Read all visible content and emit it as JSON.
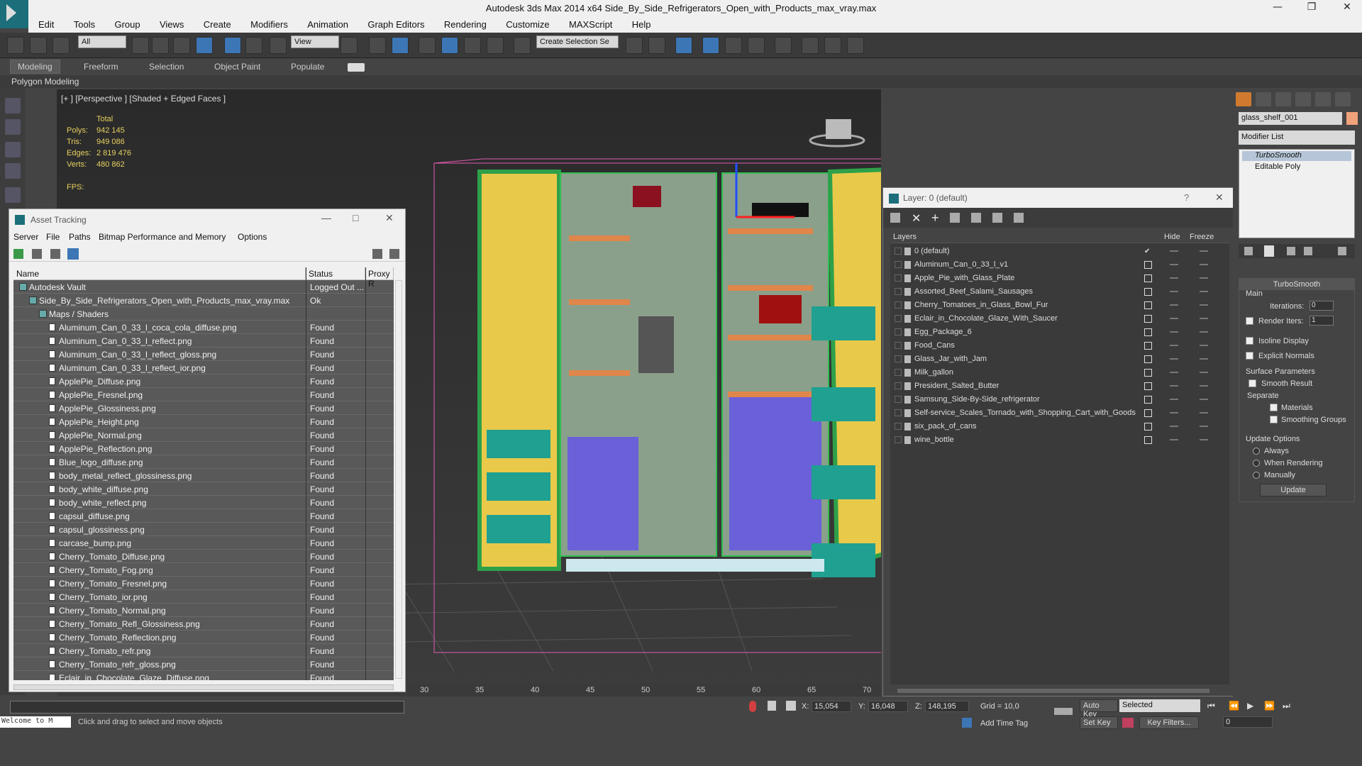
{
  "window": {
    "title": "Autodesk 3ds Max  2014 x64     Side_By_Side_Refrigerators_Open_with_Products_max_vray.max"
  },
  "menu": [
    "Edit",
    "Tools",
    "Group",
    "Views",
    "Create",
    "Modifiers",
    "Animation",
    "Graph Editors",
    "Rendering",
    "Customize",
    "MAXScript",
    "Help"
  ],
  "toolbar": {
    "filter": "All",
    "refcoord": "View",
    "selection_set": "Create Selection Se"
  },
  "ribbon": {
    "tabs": [
      "Modeling",
      "Freeform",
      "Selection",
      "Object Paint",
      "Populate"
    ],
    "sub": "Polygon Modeling"
  },
  "viewport": {
    "label": "[+ ] [Perspective ] [Shaded + Edged Faces ]",
    "stats": {
      "header": "Total",
      "polys_label": "Polys:",
      "polys": "942 145",
      "tris_label": "Tris:",
      "tris": "949 086",
      "edges_label": "Edges:",
      "edges": "2 819 476",
      "verts_label": "Verts:",
      "verts": "480 862",
      "fps_label": "FPS:"
    }
  },
  "asset_tracking": {
    "title": "Asset Tracking",
    "menu": [
      "Server",
      "File",
      "Paths",
      "Bitmap Performance and Memory",
      "Options"
    ],
    "columns": [
      "Name",
      "Status",
      "Proxy R"
    ],
    "rows": [
      {
        "name": "Autodesk Vault",
        "status": "Logged Out ...",
        "indent": 0
      },
      {
        "name": "Side_By_Side_Refrigerators_Open_with_Products_max_vray.max",
        "status": "Ok",
        "indent": 1
      },
      {
        "name": "Maps / Shaders",
        "status": "",
        "indent": 2
      },
      {
        "name": "Aluminum_Can_0_33_l_coca_cola_diffuse.png",
        "status": "Found",
        "indent": 3
      },
      {
        "name": "Aluminum_Can_0_33_l_reflect.png",
        "status": "Found",
        "indent": 3
      },
      {
        "name": "Aluminum_Can_0_33_l_reflect_gloss.png",
        "status": "Found",
        "indent": 3
      },
      {
        "name": "Aluminum_Can_0_33_l_reflect_ior.png",
        "status": "Found",
        "indent": 3
      },
      {
        "name": "ApplePie_Diffuse.png",
        "status": "Found",
        "indent": 3
      },
      {
        "name": "ApplePie_Fresnel.png",
        "status": "Found",
        "indent": 3
      },
      {
        "name": "ApplePie_Glossiness.png",
        "status": "Found",
        "indent": 3
      },
      {
        "name": "ApplePie_Height.png",
        "status": "Found",
        "indent": 3
      },
      {
        "name": "ApplePie_Normal.png",
        "status": "Found",
        "indent": 3
      },
      {
        "name": "ApplePie_Reflection.png",
        "status": "Found",
        "indent": 3
      },
      {
        "name": "Blue_logo_diffuse.png",
        "status": "Found",
        "indent": 3
      },
      {
        "name": "body_metal_reflect_glossiness.png",
        "status": "Found",
        "indent": 3
      },
      {
        "name": "body_white_diffuse.png",
        "status": "Found",
        "indent": 3
      },
      {
        "name": "body_white_reflect.png",
        "status": "Found",
        "indent": 3
      },
      {
        "name": "capsul_diffuse.png",
        "status": "Found",
        "indent": 3
      },
      {
        "name": "capsul_glossiness.png",
        "status": "Found",
        "indent": 3
      },
      {
        "name": "carcase_bump.png",
        "status": "Found",
        "indent": 3
      },
      {
        "name": "Cherry_Tomato_Diffuse.png",
        "status": "Found",
        "indent": 3
      },
      {
        "name": "Cherry_Tomato_Fog.png",
        "status": "Found",
        "indent": 3
      },
      {
        "name": "Cherry_Tomato_Fresnel.png",
        "status": "Found",
        "indent": 3
      },
      {
        "name": "Cherry_Tomato_ior.png",
        "status": "Found",
        "indent": 3
      },
      {
        "name": "Cherry_Tomato_Normal.png",
        "status": "Found",
        "indent": 3
      },
      {
        "name": "Cherry_Tomato_Refl_Glossiness.png",
        "status": "Found",
        "indent": 3
      },
      {
        "name": "Cherry_Tomato_Reflection.png",
        "status": "Found",
        "indent": 3
      },
      {
        "name": "Cherry_Tomato_refr.png",
        "status": "Found",
        "indent": 3
      },
      {
        "name": "Cherry_Tomato_refr_gloss.png",
        "status": "Found",
        "indent": 3
      },
      {
        "name": "Eclair_in_Chocolate_Glaze_Diffuse.png",
        "status": "Found",
        "indent": 3
      }
    ]
  },
  "layer_manager": {
    "title": "Layer: 0 (default)",
    "columns": [
      "Layers",
      "Hide",
      "Freeze"
    ],
    "layers": [
      "0 (default)",
      "Aluminum_Can_0_33_l_v1",
      "Apple_Pie_with_Glass_Plate",
      "Assorted_Beef_Salami_Sausages",
      "Cherry_Tomatoes_in_Glass_Bowl_Fur",
      "Eclair_in_Chocolate_Glaze_With_Saucer",
      "Egg_Package_6",
      "Food_Cans",
      "Glass_Jar_with_Jam",
      "Milk_gallon",
      "President_Salted_Butter",
      "Samsung_Side-By-Side_refrigerator",
      "Self-service_Scales_Tornado_with_Shopping_Cart_with_Goods",
      "six_pack_of_cans",
      "wine_bottle"
    ]
  },
  "command_panel": {
    "object_name": "glass_shelf_001",
    "modifier_list": "Modifier List",
    "stack": [
      "TurboSmooth",
      "Editable Poly"
    ],
    "rollout": "TurboSmooth",
    "main": "Main",
    "iterations_label": "Iterations:",
    "iterations": "0",
    "render_iters_label": "Render Iters:",
    "render_iters": "1",
    "isoline": "Isoline Display",
    "explicit_normals": "Explicit Normals",
    "surface_params": "Surface Parameters",
    "smooth_result": "Smooth Result",
    "separate": "Separate",
    "materials": "Materials",
    "smoothing_groups": "Smoothing Groups",
    "update_options": "Update Options",
    "always": "Always",
    "when_rendering": "When Rendering",
    "manually": "Manually",
    "update_btn": "Update"
  },
  "timeline": {
    "ticks": [
      "30",
      "35",
      "40",
      "45",
      "50",
      "55",
      "60",
      "65",
      "70"
    ]
  },
  "status": {
    "maxscript": "Welcome to M",
    "prompt": "Click and drag to select and move objects",
    "x_label": "X:",
    "x": "15,054",
    "y_label": "Y:",
    "y": "16,048",
    "z_label": "Z:",
    "z": "148,195",
    "grid": "Grid = 10,0",
    "add_time_tag": "Add Time Tag",
    "auto_key": "Auto Key",
    "selected": "Selected",
    "set_key": "Set Key",
    "key_filters": "Key Filters...",
    "frame": "0"
  }
}
